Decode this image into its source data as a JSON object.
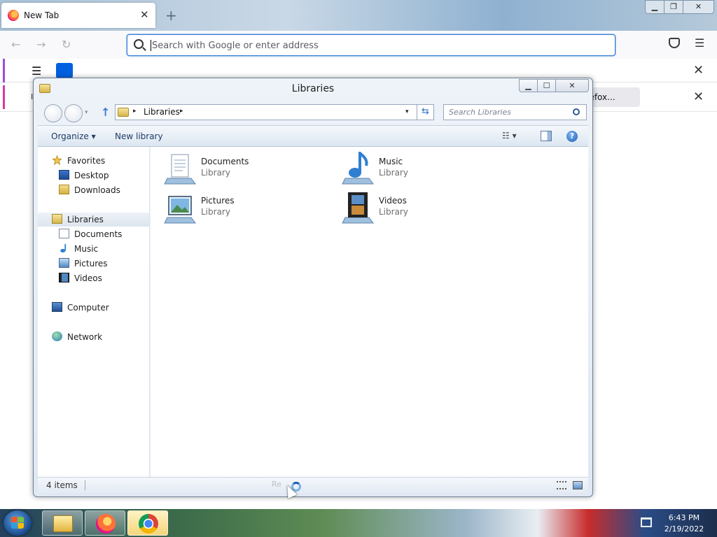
{
  "firefox": {
    "tab_title": "New Tab",
    "tab_close": "✕",
    "new_tab": "+",
    "window_controls": {
      "minimize": "▁",
      "restore": "❐",
      "close": "✕"
    },
    "nav": {
      "back": "←",
      "forward": "→",
      "reload": "↻"
    },
    "url_placeholder": "Search with Google or enter address",
    "menu": "☰",
    "notification1": {
      "menu": "☰",
      "close": "✕"
    },
    "notification2": {
      "lead_char": "I",
      "button": "h Firefox...",
      "close": "✕"
    }
  },
  "explorer": {
    "title": "Libraries",
    "controls": {
      "minimize": "▁",
      "maximize": "☐",
      "close": "✕"
    },
    "nav": {
      "history": "▾",
      "up": "↑"
    },
    "address": {
      "crumb": "Libraries",
      "arrow": "▸",
      "drop": "▾"
    },
    "refresh": "⇆",
    "search_placeholder": "Search Libraries",
    "toolbar": {
      "organize": "Organize ▾",
      "new_library": "New library",
      "views": "☷ ▾",
      "help": "?"
    },
    "sidebar": {
      "favorites": {
        "label": "Favorites",
        "items": [
          "Desktop",
          "Downloads"
        ]
      },
      "libraries": {
        "label": "Libraries",
        "items": [
          "Documents",
          "Music",
          "Pictures",
          "Videos"
        ]
      },
      "computer": "Computer",
      "network": "Network"
    },
    "items": [
      {
        "name": "Documents",
        "type": "Library"
      },
      {
        "name": "Music",
        "type": "Library"
      },
      {
        "name": "Pictures",
        "type": "Library"
      },
      {
        "name": "Videos",
        "type": "Library"
      }
    ],
    "status": {
      "count": "4 items",
      "ghost": "Re"
    }
  },
  "taskbar": {
    "time": "6:43 PM",
    "date": "2/19/2022"
  },
  "colors": {
    "accent_blue": "#0060df",
    "link_blue": "#1e3d66"
  }
}
